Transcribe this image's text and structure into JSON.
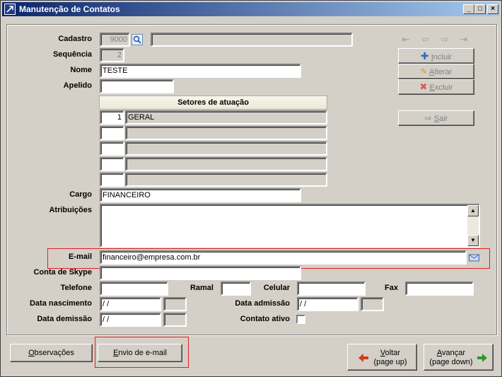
{
  "window": {
    "title": "Manutenção de Contatos"
  },
  "form": {
    "cadastro": {
      "label": "Cadastro",
      "value": "9000",
      "name_value": ""
    },
    "sequencia": {
      "label": "Sequência",
      "value": "2"
    },
    "nome": {
      "label": "Nome",
      "value": "TESTE"
    },
    "apelido": {
      "label": "Apelido",
      "value": ""
    },
    "setores": {
      "header": "Setores de atuação",
      "rows": [
        {
          "code": "1",
          "name": "GERAL"
        },
        {
          "code": "",
          "name": ""
        },
        {
          "code": "",
          "name": ""
        },
        {
          "code": "",
          "name": ""
        },
        {
          "code": "",
          "name": ""
        }
      ]
    },
    "cargo": {
      "label": "Cargo",
      "value": "FINANCEIRO"
    },
    "atribuicoes": {
      "label": "Atribuições",
      "value": ""
    },
    "email": {
      "label": "E-mail",
      "value": "financeiro@empresa.com.br"
    },
    "skype": {
      "label": "Conta de Skype",
      "value": ""
    },
    "telefone": {
      "label": "Telefone",
      "value": ""
    },
    "ramal": {
      "label": "Ramal",
      "value": ""
    },
    "celular": {
      "label": "Celular",
      "value": ""
    },
    "fax": {
      "label": "Fax",
      "value": ""
    },
    "data_nascimento": {
      "label": "Data nascimento",
      "value": " / /"
    },
    "data_admissao": {
      "label": "Data admissão",
      "value": " / /"
    },
    "data_demissao": {
      "label": "Data demissão",
      "value": " / /"
    },
    "contato_ativo": {
      "label": "Contato ativo",
      "checked": false
    }
  },
  "actions": {
    "incluir": {
      "key": "I",
      "rest": "ncluir"
    },
    "alterar": {
      "key": "A",
      "rest": "lterar"
    },
    "excluir": {
      "key": "E",
      "rest": "xcluir"
    },
    "sair": {
      "key": "S",
      "rest": "air"
    }
  },
  "bottom": {
    "observacoes": {
      "key": "O",
      "rest": "bservações"
    },
    "envio_email": {
      "key": "E",
      "rest": "nvio de e-mail"
    },
    "voltar": {
      "key": "V",
      "rest": "oltar",
      "hint": "(page up)"
    },
    "avancar": {
      "key": "A",
      "rest": "vançar",
      "hint": "(page down)"
    }
  },
  "colors": {
    "accent_red": "#e02020",
    "title_bar": "#0a246a",
    "arrow_green": "#2a9a2a",
    "arrow_red": "#d03a1a"
  },
  "icons": [
    "lookup-icon",
    "first-record-icon",
    "prev-record-icon",
    "next-record-icon",
    "last-record-icon",
    "plus-icon",
    "edit-icon",
    "delete-icon",
    "exit-icon",
    "mail-icon",
    "arrow-left-icon",
    "arrow-right-icon"
  ]
}
